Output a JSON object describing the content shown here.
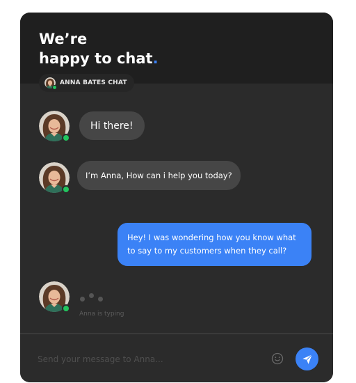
{
  "header": {
    "title_line1": "We’re",
    "title_line2": "happy to chat",
    "title_dot": ".",
    "agent_pill_label": "ANNA BATES CHAT"
  },
  "messages": [
    {
      "from": "agent",
      "text": "Hi there!"
    },
    {
      "from": "agent",
      "text": "I’m Anna, How can i help you today?"
    },
    {
      "from": "user",
      "text": "Hey! I was wondering how you know what to say to my customers when they call?"
    }
  ],
  "typing": {
    "label": "Anna is typing"
  },
  "composer": {
    "placeholder": "Send your message to Anna..."
  },
  "icons": {
    "emoji": "smiley-icon",
    "send": "paper-plane-icon",
    "status": "online-status-icon"
  },
  "colors": {
    "accent": "#3b82f6",
    "online": "#22c55e",
    "panel": "#2b2b2b",
    "header": "#1f1f1f",
    "agent_bubble": "#464646"
  }
}
